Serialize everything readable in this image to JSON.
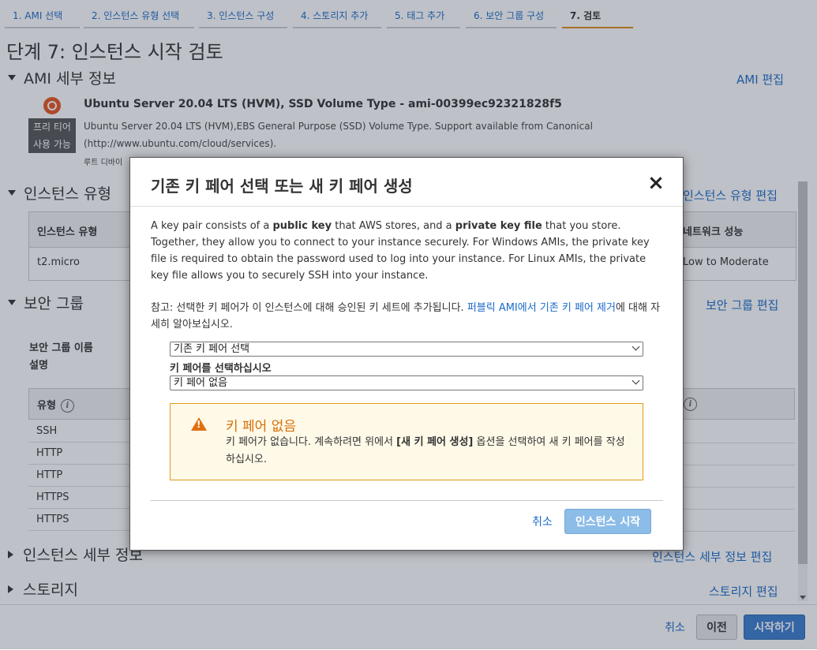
{
  "tabs": [
    {
      "label": "1. AMI 선택"
    },
    {
      "label": "2. 인스턴스 유형 선택"
    },
    {
      "label": "3. 인스턴스 구성"
    },
    {
      "label": "4. 스토리지 추가"
    },
    {
      "label": "5. 태그 추가"
    },
    {
      "label": "6. 보안 그룹 구성"
    },
    {
      "label": "7. 검토"
    }
  ],
  "page_title": "단계 7: 인스턴스 시작 검토",
  "ami": {
    "section_title": "AMI 세부 정보",
    "edit_label": "AMI 편집",
    "badge_line1": "프리 티어",
    "badge_line2": "사용 가능",
    "name": "Ubuntu Server 20.04 LTS (HVM), SSD Volume Type - ami-00399ec92321828f5",
    "desc_line1": "Ubuntu Server 20.04 LTS (HVM),EBS General Purpose (SSD) Volume Type. Support available from Canonical",
    "desc_line2": "(http://www.ubuntu.com/cloud/services).",
    "root_device": "루트 디바이"
  },
  "instance_type": {
    "section_title": "인스턴스 유형",
    "edit_label": "인스턴스 유형 편집",
    "col_type": "인스턴스 유형",
    "col_network": "네트워크 성능",
    "row_type": "t2.micro",
    "row_network": "Low to Moderate"
  },
  "security_group": {
    "section_title": "보안 그룹",
    "edit_label": "보안 그룹 편집",
    "name_label": "보안 그룹 이름",
    "desc_label": "설명",
    "col_type": "유형",
    "info_glyph": "i",
    "rows": [
      "SSH",
      "HTTP",
      "HTTP",
      "HTTPS",
      "HTTPS"
    ]
  },
  "instance_details": {
    "section_title": "인스턴스 세부 정보",
    "edit_label": "인스턴스 세부 정보 편집"
  },
  "storage": {
    "section_title": "스토리지",
    "edit_label": "스토리지 편집"
  },
  "bottom_bar": {
    "cancel": "취소",
    "previous": "이전",
    "launch": "시작하기"
  },
  "modal": {
    "title": "기존 키 페어 선택 또는 새 키 페어 생성",
    "close_glyph": "×",
    "para_part1": "A key pair consists of a ",
    "para_bold1": "public key",
    "para_part2": " that AWS stores, and a ",
    "para_bold2": "private key file",
    "para_part3": " that you store. Together, they allow you to connect to your instance securely. For Windows AMIs, the private key file is required to obtain the password used to log into your instance. For Linux AMIs, the private key file allows you to securely SSH into your instance.",
    "note_text": "참고: 선택한 키 페어가 이 인스턴스에 대해 승인된 키 세트에 추가됩니다. ",
    "note_link": "퍼블릭 AMI에서 기존 키 페어 제거",
    "note_suffix": "에 대해 자세히 알아보십시오.",
    "select1_value": "기존 키 페어 선택",
    "select_label": "키 페어를 선택하십시오",
    "select2_value": "키 페어 없음",
    "warning_title": "키 페어 없음",
    "warning_text1": "키 페어가 없습니다. 계속하려면 위에서 ",
    "warning_bold": "[새 키 페어 생성]",
    "warning_text2": " 옵션을 선택하여 새 키 페어를 작성하십시오.",
    "cancel": "취소",
    "launch": "인스턴스 시작"
  },
  "colors": {
    "link": "#1b6ac9",
    "primary_button": "#3a7ccf",
    "disabled_button": "#8cbce8",
    "warning_orange": "#e26f0e",
    "active_tab_underline": "#e08b1b"
  }
}
